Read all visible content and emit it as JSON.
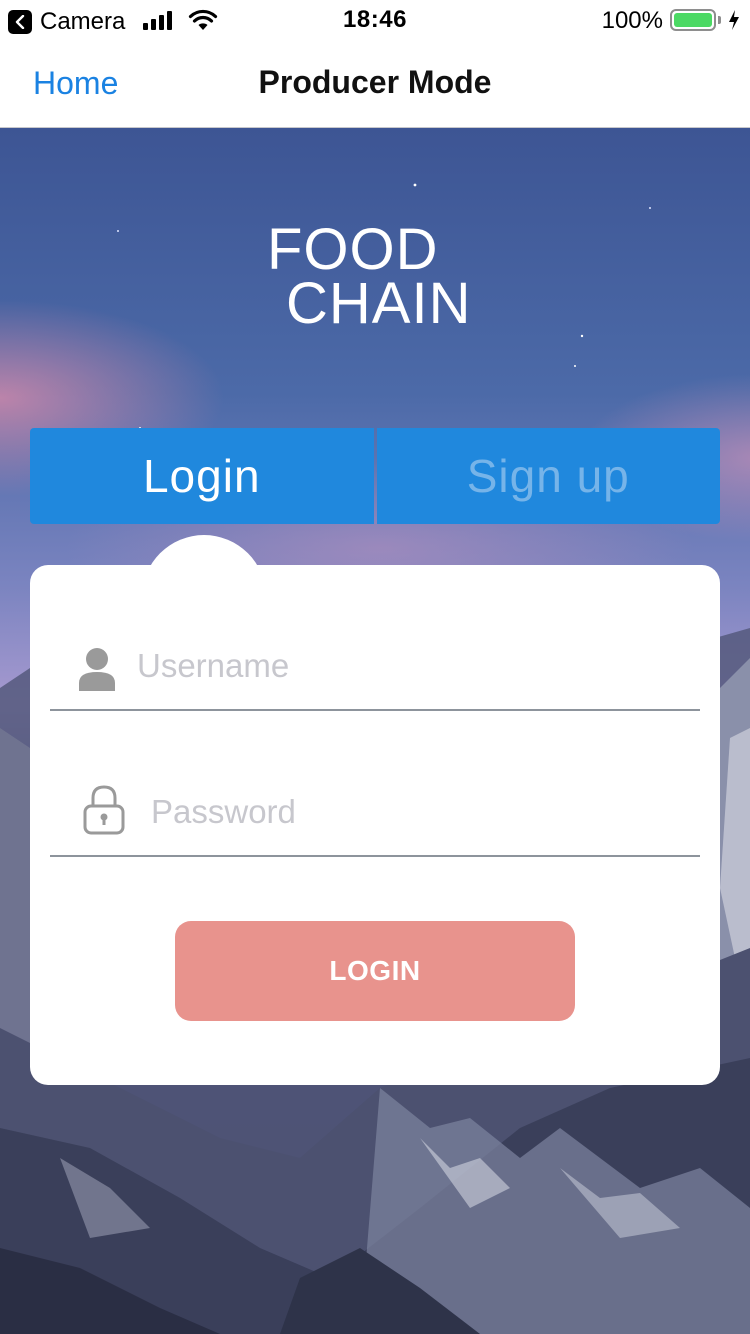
{
  "status_bar": {
    "back_app_label": "Camera",
    "time": "18:46",
    "battery_percent": "100%",
    "battery_level": 1.0,
    "signal_bars": 4
  },
  "nav": {
    "back_label": "Home",
    "title": "Producer Mode"
  },
  "logo": {
    "line1": "FOOD",
    "line2": "CHAIN"
  },
  "tabs": [
    {
      "label": "Login",
      "active": true
    },
    {
      "label": "Sign up",
      "active": false
    }
  ],
  "form": {
    "username_placeholder": "Username",
    "password_placeholder": "Password",
    "submit_label": "LOGIN"
  },
  "colors": {
    "accent": "#1a82e2",
    "tab_bg": "#2088dd",
    "button": "#e8938d",
    "battery_fill": "#4cd964"
  },
  "icons": {
    "username": "person-icon",
    "password": "lock-icon"
  }
}
